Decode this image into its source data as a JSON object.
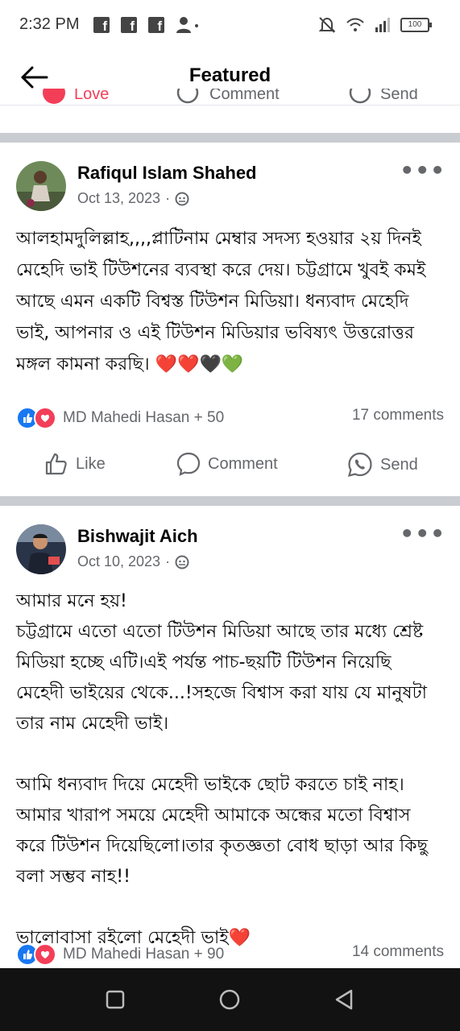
{
  "status_bar": {
    "time": "2:32 PM",
    "battery": "100"
  },
  "header": {
    "title": "Featured"
  },
  "prev_post_actions": {
    "love": "Love",
    "comment": "Comment",
    "send": "Send"
  },
  "posts": [
    {
      "author": "Rafiqul Islam Shahed",
      "date": "Oct 13, 2023",
      "separator": "·",
      "text": "আলহামদুলিল্লাহ,,,,প্লাটিনাম মেম্বার সদস্য হওয়ার ২য় দিনই মেহেদি ভাই টিউশনের ব্যবস্থা করে দেয়। চট্টগ্রামে খুবই কমই আছে এমন একটি বিশ্বস্ত টিউশন মিডিয়া। ধন্যবাদ মেহেদি ভাই, আপনার ও এই টিউশন মিডিয়ার ভবিষ্যৎ উত্তরোত্তর মঙ্গল কামনা করছি। ❤️❤️🖤💚",
      "reactions": "MD Mahedi Hasan + 50",
      "comments": "17 comments",
      "like_label": "Like",
      "comment_label": "Comment",
      "send_label": "Send"
    },
    {
      "author": "Bishwajit Aich",
      "date": "Oct 10, 2023",
      "separator": "·",
      "text": "আমার মনে হয়!\nচট্টগ্রামে এতো এতো টিউশন মিডিয়া আছে তার মধ্যে শ্রেষ্ট মিডিয়া হচ্ছে এটি।এই পর্যন্ত পাচ-ছয়টি টিউশন নিয়েছি মেহেদী ভাইয়ের থেকে...!সহজে বিশ্বাস করা যায় যে মানুষটা তার নাম মেহেদী ভাই।\n\nআমি ধন্যবাদ দিয়ে মেহেদী ভাইকে ছোট করতে চাই নাহ।আমার খারাপ সময়ে মেহেদী আমাকে অন্ধের মতো বিশ্বাস করে টিউশন দিয়েছিলো।তার কৃতজ্ঞতা বোধ ছাড়া আর কিছু বলা সম্ভব নাহ!!\n\nভালোবাসা রইলো মেহেদী ভাই❤️",
      "reactions": "MD Mahedi Hasan + 90",
      "comments": "14 comments"
    }
  ],
  "icons": [
    "back-arrow-icon",
    "more-icon",
    "globe-icon",
    "like-icon",
    "love-icon",
    "comment-icon",
    "send-icon",
    "messenger-icon"
  ],
  "colors": {
    "like": "#1877f2",
    "love": "#f33e58",
    "secondary_text": "#65676b",
    "divider": "#c9ccd1",
    "navbar": "#121212"
  }
}
